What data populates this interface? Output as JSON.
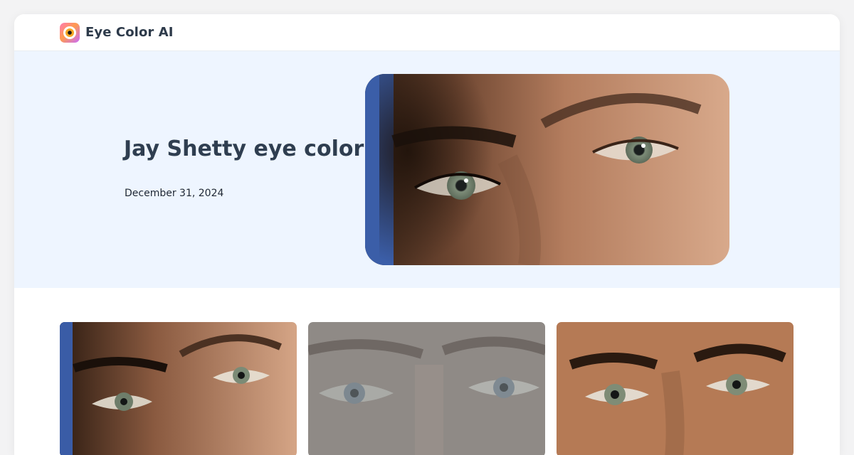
{
  "header": {
    "brand_name": "Eye Color AI",
    "logo_icon": "eye-logo-icon"
  },
  "hero": {
    "title": "Jay Shetty eye color",
    "date": "December 31, 2024",
    "image_alt": "Close-up of Jay Shetty's eyes"
  },
  "gallery": {
    "items": [
      {
        "name": "gallery-photo-warm",
        "alt": "Close-up of eyes, warm lighting"
      },
      {
        "name": "gallery-photo-gray",
        "alt": "Close-up of eyes, desaturated"
      },
      {
        "name": "gallery-photo-front",
        "alt": "Front-facing close-up of eyes"
      }
    ]
  },
  "colors": {
    "hero_background": "#eef5ff",
    "brand_text": "#2d3a4a",
    "iris_green_gray": "#8a9a86"
  }
}
